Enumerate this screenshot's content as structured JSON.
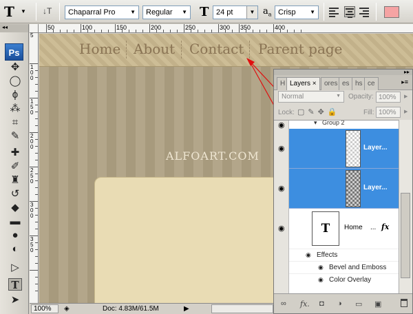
{
  "options_bar": {
    "tool_glyph": "T",
    "font_family": "Chaparral Pro",
    "font_style": "Regular",
    "font_size": "24 pt",
    "aa_label": "a",
    "aa_mode": "Crisp",
    "text_color": "#f5a3a3"
  },
  "toolbox": {
    "logo": "Ps",
    "tools": [
      "move-icon",
      "marquee-icon",
      "lasso-icon",
      "magic-wand-icon",
      "crop-icon",
      "slice-icon",
      "healing-icon",
      "brush-icon",
      "stamp-icon",
      "history-brush-icon",
      "eraser-icon",
      "gradient-icon",
      "blur-icon",
      "dodge-icon",
      "pen-icon",
      "type-icon",
      "path-select-icon"
    ]
  },
  "ruler_top": [
    "50",
    "100",
    "150",
    "200",
    "250",
    "300",
    "350",
    "400"
  ],
  "ruler_left": [
    "5",
    "1\n0\n0",
    "1\n5\n0",
    "2\n0\n0",
    "2\n5\n0",
    "3\n0\n0",
    "3\n5\n0"
  ],
  "canvas": {
    "nav": [
      "Home",
      "About",
      "Contact",
      "Parent page"
    ],
    "watermark": "ALFOART.COM"
  },
  "status": {
    "zoom": "100%",
    "doc": "Doc: 4.83M/61.5M"
  },
  "layers_panel": {
    "tabs": [
      "H",
      "Layers",
      "×",
      "ores",
      "es",
      "hs",
      "ce"
    ],
    "blend_mode": "Normal",
    "opacity_label": "Opacity:",
    "opacity_value": "100%",
    "lock_label": "Lock:",
    "fill_label": "Fill:",
    "fill_value": "100%",
    "group_name": "Group 2",
    "layers": [
      {
        "name": "Layer...",
        "selected": true
      },
      {
        "name": "Layer...",
        "selected": true
      }
    ],
    "text_layer": {
      "thumb": "T",
      "name": "Home",
      "dots": "...",
      "fx": "fx"
    },
    "effects_label": "Effects",
    "effects": [
      "Bevel and Emboss",
      "Color Overlay"
    ]
  }
}
